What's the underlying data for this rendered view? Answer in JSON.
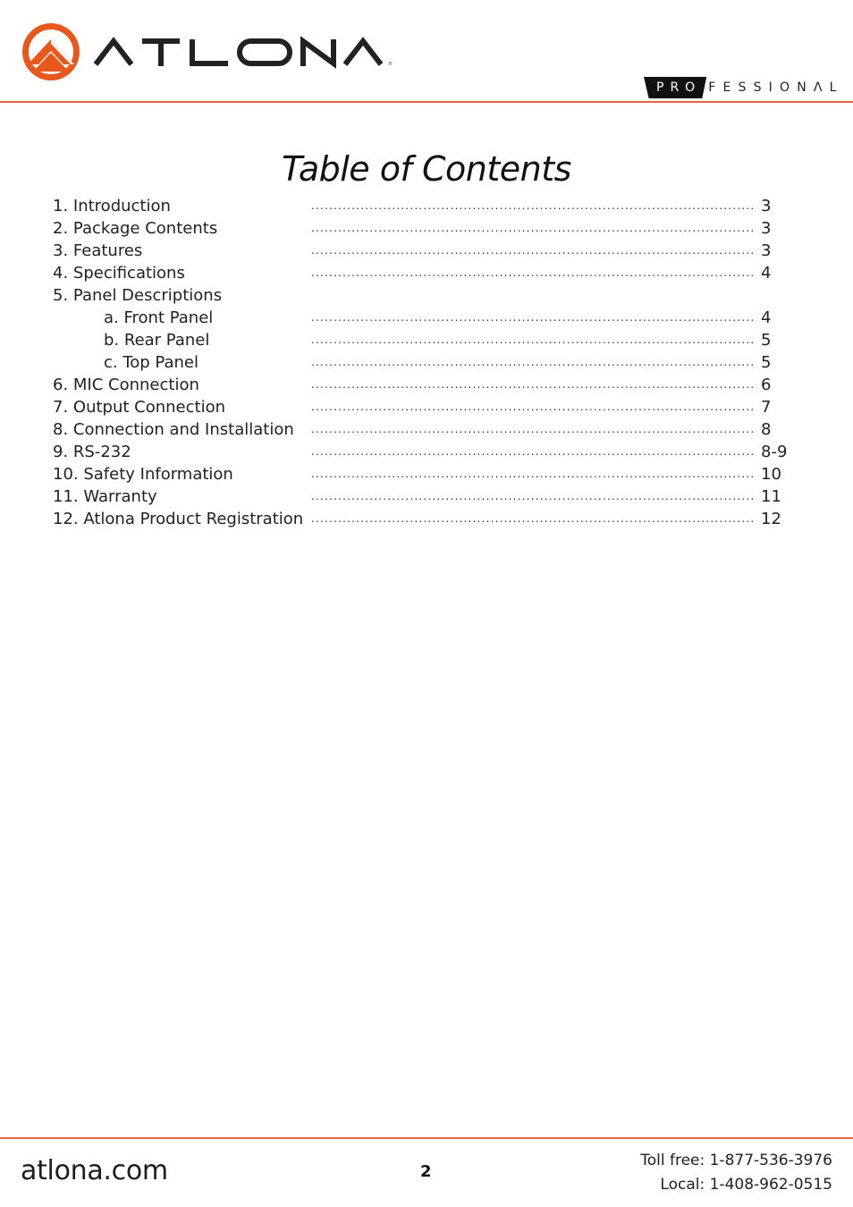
{
  "header": {
    "brand_name": "ATLONA",
    "brand_mark": "atlona-logo",
    "tagline_dark": "PRO",
    "tagline_rest": "FESSIONΛL",
    "accent_color": "#e8643c"
  },
  "title": "Table of Contents",
  "toc": {
    "dots": "..................................................................................................................................",
    "entries": [
      {
        "label": "1. Introduction",
        "page": "3",
        "level": 1
      },
      {
        "label": "2. Package Contents",
        "page": "3",
        "level": 1
      },
      {
        "label": "3. Features",
        "page": "3",
        "level": 1
      },
      {
        "label": "4. Specifications",
        "page": "4",
        "level": 1
      },
      {
        "label": "5. Panel Descriptions",
        "page": "",
        "level": 1
      },
      {
        "label": "a. Front Panel",
        "page": "4",
        "level": 2
      },
      {
        "label": "b. Rear Panel",
        "page": "5",
        "level": 2
      },
      {
        "label": "c. Top Panel",
        "page": "5",
        "level": 2
      },
      {
        "label": "6. MIC Connection",
        "page": "6",
        "level": 1
      },
      {
        "label": "7. Output Connection",
        "page": "7",
        "level": 1
      },
      {
        "label": "8. Connection and Installation",
        "page": "8",
        "level": 1
      },
      {
        "label": "9. RS-232",
        "page": "8-9",
        "level": 1
      },
      {
        "label": "10. Safety Information",
        "page": "10",
        "level": 1
      },
      {
        "label": "11. Warranty",
        "page": "11",
        "level": 1
      },
      {
        "label": "12. Atlona Product Registration",
        "page": "12",
        "level": 1
      }
    ]
  },
  "footer": {
    "website": "atlona.com",
    "page_number": "2",
    "toll_free": "Toll free: 1-877-536-3976",
    "local": "Local: 1-408-962-0515"
  }
}
